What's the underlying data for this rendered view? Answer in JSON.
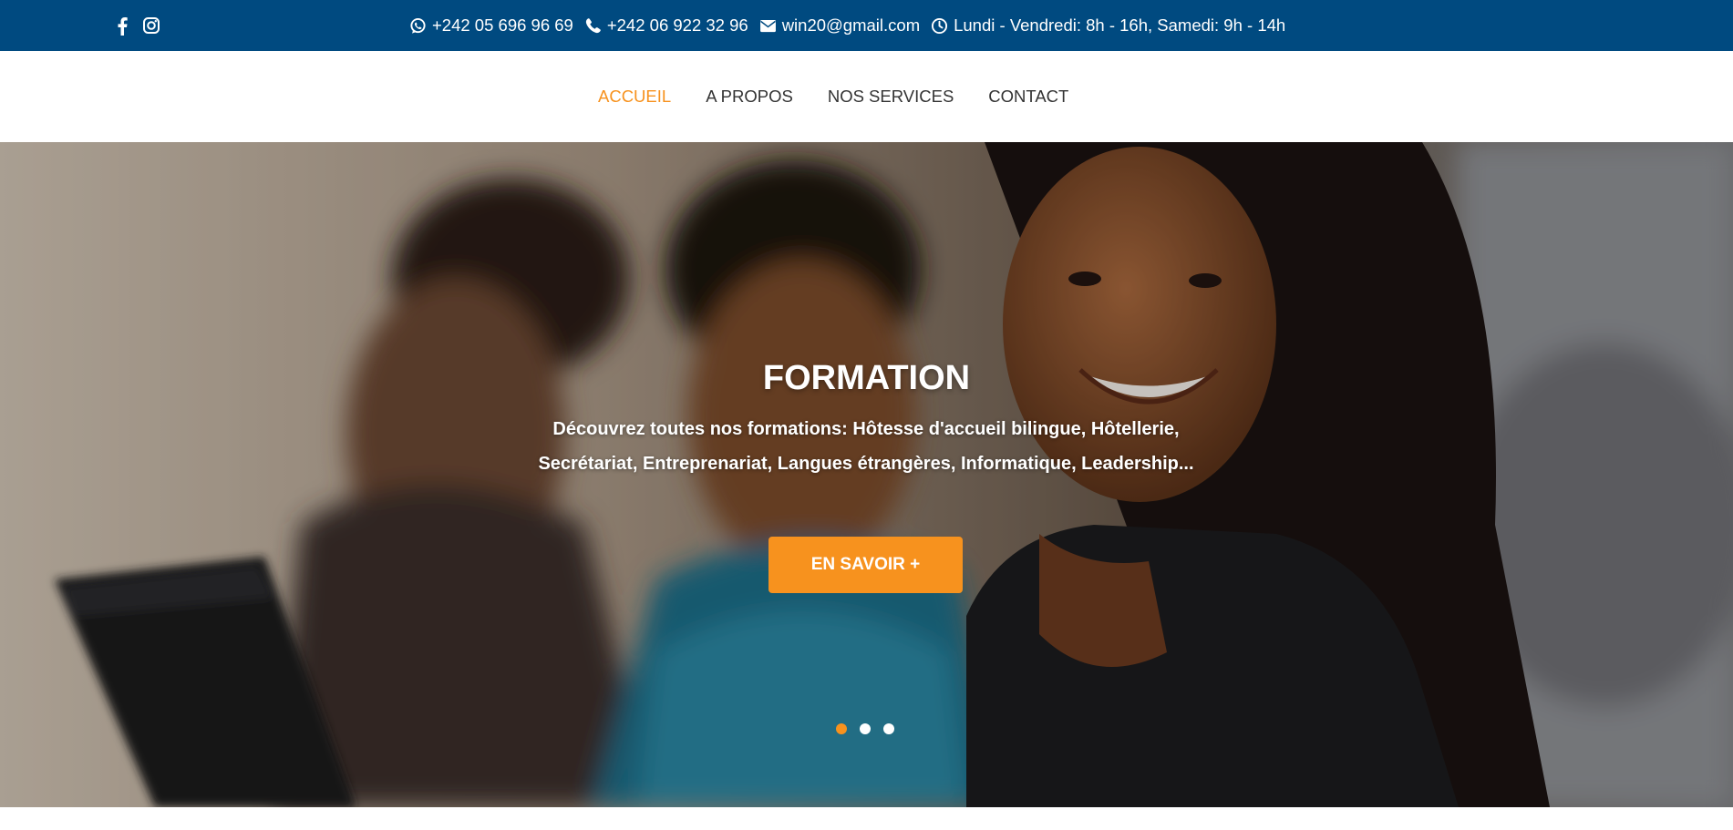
{
  "topbar": {
    "social": [
      {
        "icon": "facebook-icon"
      },
      {
        "icon": "instagram-icon"
      }
    ],
    "contacts": [
      {
        "icon": "whatsapp-icon",
        "text": "+242 05 696 96 69"
      },
      {
        "icon": "phone-icon",
        "text": "+242 06 922 32 96"
      },
      {
        "icon": "envelope-icon",
        "text": "win20@gmail.com"
      },
      {
        "icon": "clock-icon",
        "text": "Lundi - Vendredi: 8h - 16h, Samedi: 9h - 14h"
      }
    ],
    "background": "#004a80"
  },
  "nav": {
    "items": [
      {
        "label": "ACCUEIL",
        "active": true
      },
      {
        "label": "A PROPOS",
        "active": false
      },
      {
        "label": "NOS SERVICES",
        "active": false
      },
      {
        "label": "CONTACT",
        "active": false
      }
    ],
    "active_color": "#f7921e"
  },
  "hero": {
    "title": "FORMATION",
    "description": "Découvrez toutes nos formations: Hôtesse d'accueil bilingue, Hôtellerie, Secrétariat, Entreprenariat, Langues étrangères, Informatique, Leadership...",
    "button_label": "EN SAVOIR +",
    "button_color": "#f7921e",
    "slides": {
      "count": 3,
      "active_index": 0
    }
  }
}
